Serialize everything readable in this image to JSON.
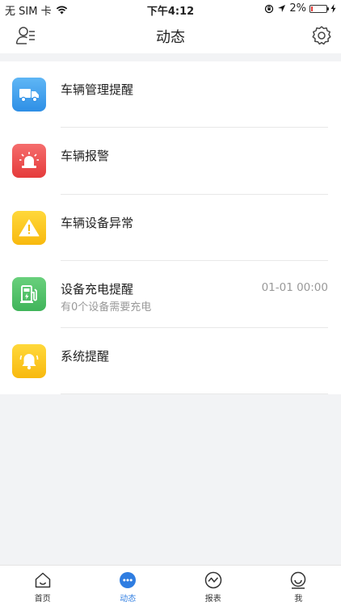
{
  "status_bar": {
    "carrier": "无 SIM 卡",
    "time": "下午4:12",
    "battery_percent": "2%",
    "battery_level": 0.02
  },
  "header": {
    "title": "动态"
  },
  "list": {
    "items": [
      {
        "title": "车辆管理提醒",
        "icon": "truck-icon",
        "color": "#3a9aeb"
      },
      {
        "title": "车辆报警",
        "icon": "siren-icon",
        "color": "#ef5050"
      },
      {
        "title": "车辆设备异常",
        "icon": "warning-icon",
        "color": "#f9c41d"
      },
      {
        "title": "设备充电提醒",
        "subtitle": "有0个设备需要充电",
        "time": "01-01 00:00",
        "icon": "charging-station-icon",
        "color": "#52c268"
      },
      {
        "title": "系统提醒",
        "icon": "bell-icon",
        "color": "#f9c41d"
      }
    ]
  },
  "tabbar": {
    "tabs": [
      {
        "label": "首页",
        "icon": "home-icon",
        "active": false
      },
      {
        "label": "动态",
        "icon": "chat-dots-icon",
        "active": true
      },
      {
        "label": "报表",
        "icon": "chart-icon",
        "active": false
      },
      {
        "label": "我",
        "icon": "smiley-icon",
        "active": false
      }
    ],
    "active_color": "#2f7de1"
  }
}
